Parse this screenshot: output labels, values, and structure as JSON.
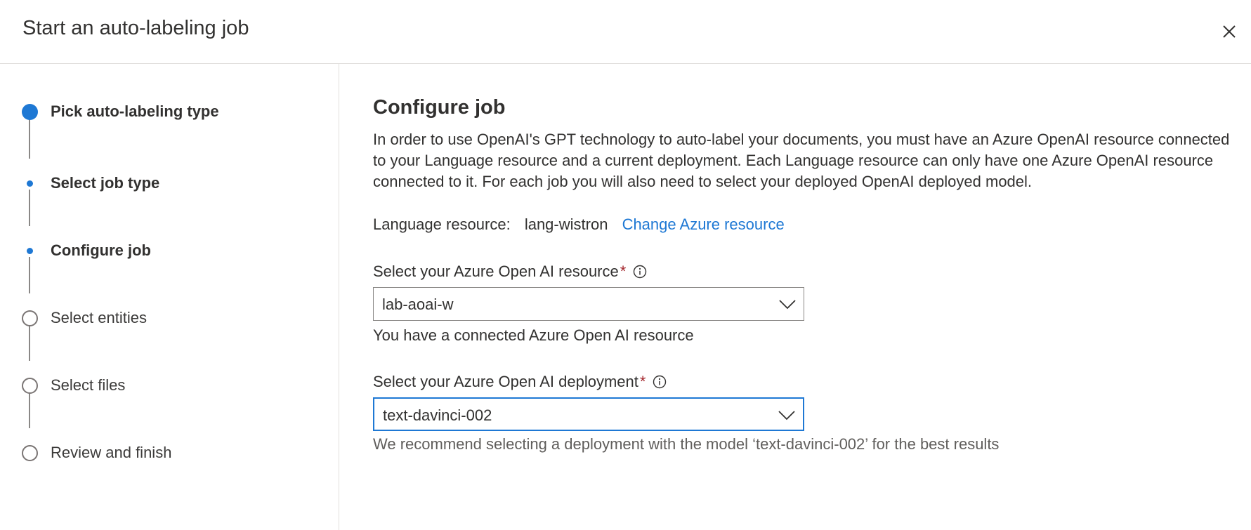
{
  "dialog": {
    "title": "Start an auto-labeling job",
    "close_icon": "close-icon"
  },
  "steps": [
    {
      "label": "Pick auto-labeling type",
      "state": "current"
    },
    {
      "label": "Select job type",
      "state": "current-sub"
    },
    {
      "label": "Configure job",
      "state": "current-sub"
    },
    {
      "label": "Select entities",
      "state": "upcoming"
    },
    {
      "label": "Select files",
      "state": "upcoming"
    },
    {
      "label": "Review and finish",
      "state": "upcoming"
    }
  ],
  "main": {
    "heading": "Configure job",
    "description": "In order to use OpenAI's GPT technology to auto-label your documents, you must have an Azure OpenAI resource connected to your Language resource and a current deployment. Each Language resource can only have one Azure OpenAI resource connected to it. For each job you will also need to select your deployed OpenAI deployed model.",
    "language_resource_label": "Language resource:",
    "language_resource_value": "lang-wistron",
    "change_resource_link": "Change Azure resource",
    "aoai_resource": {
      "label": "Select your Azure Open AI resource",
      "required_mark": "*",
      "selected": "lab-aoai-w",
      "helper": "You have a connected Azure Open AI resource"
    },
    "aoai_deployment": {
      "label": "Select your Azure Open AI deployment",
      "required_mark": "*",
      "selected": "text-davinci-002",
      "helper": "We recommend selecting a deployment with the model ‘text-davinci-002’ for the best results"
    }
  },
  "colors": {
    "accent": "#1e78d4",
    "required": "#a4262c",
    "border": "#8a8886"
  }
}
